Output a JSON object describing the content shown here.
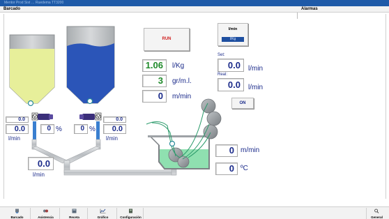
{
  "window": {
    "title_text": "Mentor Prod Sist … Ruedema TT3200"
  },
  "header": {
    "left_title": "Barcado",
    "right_title": "Alarmas"
  },
  "controls": {
    "run_label": "RUN",
    "unit_toggle": {
      "top_label": "l/min",
      "selected_label": "l/Kg"
    },
    "on_label": "ON"
  },
  "readouts": {
    "ratio": {
      "value": "1.06",
      "unit": "l/Kg",
      "color": "#1f8a2a"
    },
    "concentration": {
      "value": "3",
      "unit": "gr/m.l.",
      "color": "#1f8a2a"
    },
    "speed_center": {
      "value": "0",
      "unit": "m/min"
    },
    "set": {
      "label": "Set:",
      "value": "0.0",
      "unit": "l/min"
    },
    "real": {
      "label": "Real:",
      "value": "0.0",
      "unit": "l/min"
    },
    "bath_speed": {
      "value": "0",
      "unit": "m/min"
    },
    "bath_temp": {
      "value": "0",
      "unit": "ºC"
    },
    "left_pump": {
      "small_value": "0.0",
      "value": "0.0",
      "unit": "l/min",
      "percent": "0",
      "percent_unit": "%"
    },
    "right_pump": {
      "small_value": "0.0",
      "value": "0.0",
      "unit": "l/min",
      "percent": "0",
      "percent_unit": "%"
    },
    "total_flow": {
      "value": "0.0",
      "unit": "l/min"
    }
  },
  "tanks": {
    "left": {
      "liquid_color": "#e7ef9a",
      "fill_level": 0.7
    },
    "right": {
      "liquid_color": "#2b55b8",
      "fill_level": 0.72
    },
    "bath_color": "#8fe0b0"
  },
  "nav": {
    "items": [
      {
        "label": "Barcado",
        "icon": "tank-icon"
      },
      {
        "label": "Asistencia",
        "icon": "assist-icon"
      },
      {
        "label": "Receta",
        "icon": "recipe-icon"
      },
      {
        "label": "Gráfico",
        "icon": "chart-icon"
      },
      {
        "label": "Configuración",
        "icon": "config-icon"
      }
    ],
    "general_label": "General"
  },
  "colors": {
    "accent_bar": "#1e5aa8",
    "value_text": "#1a2a8a",
    "run_text": "#d02020",
    "pipe": "#c2c6c9"
  }
}
